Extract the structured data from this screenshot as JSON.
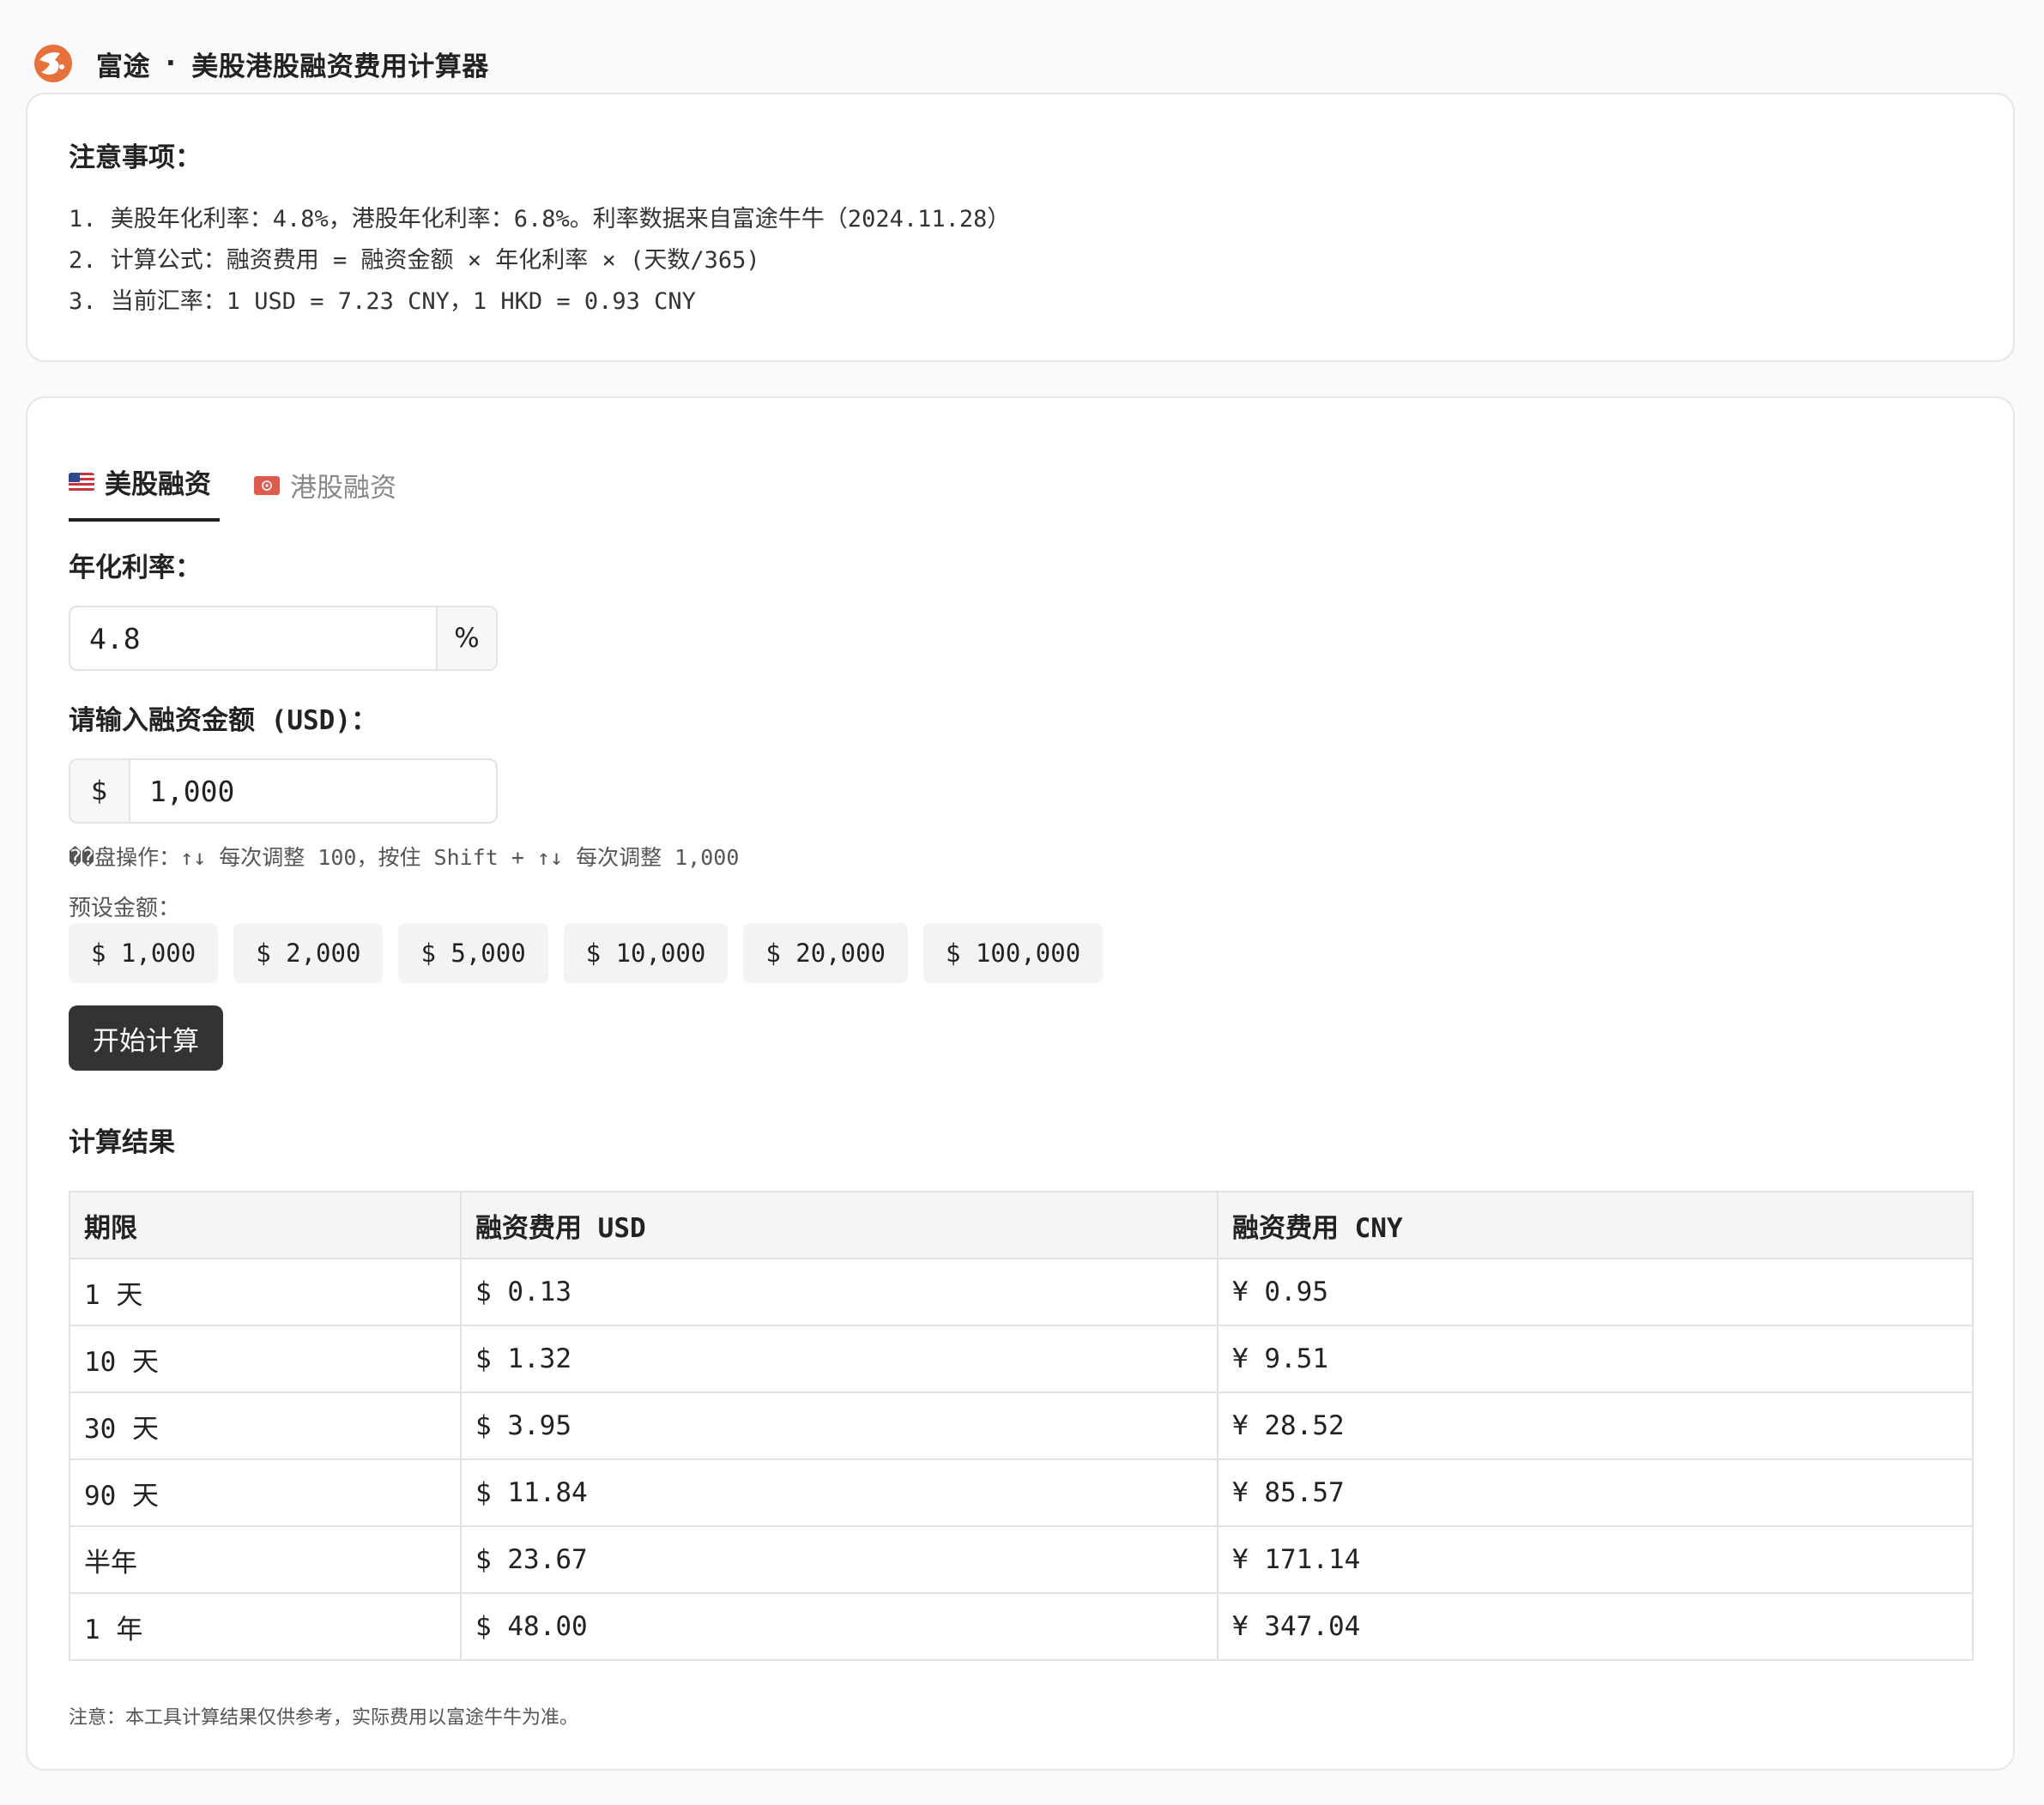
{
  "header": {
    "brand": "富途",
    "separator": "·",
    "title": "美股港股融资费用计算器"
  },
  "notes": {
    "title": "注意事项：",
    "items": [
      "1. 美股年化利率：4.8%，港股年化利率：6.8%。利率数据来自富途牛牛（2024.11.28）",
      "2. 计算公式：融资费用 = 融资金额 × 年化利率 × (天数/365)",
      "3. 当前汇率：1 USD = 7.23 CNY，1 HKD = 0.93 CNY"
    ]
  },
  "tabs": [
    {
      "label": "美股融资",
      "active": true
    },
    {
      "label": "港股融资",
      "active": false
    }
  ],
  "rate": {
    "label": "年化利率：",
    "value": "4.8",
    "unit": "%"
  },
  "amount": {
    "label": "请输入融资金额 (USD)：",
    "prefix": "$",
    "value": "1,000"
  },
  "hint": "��盘操作：↑↓ 每次调整 100，按住 Shift + ↑↓ 每次调整 1,000",
  "presets": {
    "label": "预设金额：",
    "items": [
      "$ 1,000",
      "$ 2,000",
      "$ 5,000",
      "$ 10,000",
      "$ 20,000",
      "$ 100,000"
    ]
  },
  "calculate_button": "开始计算",
  "results": {
    "title": "计算结果",
    "headers": [
      "期限",
      "融资费用 USD",
      "融资费用 CNY"
    ],
    "rows": [
      [
        "1 天",
        "$ 0.13",
        "¥ 0.95"
      ],
      [
        "10 天",
        "$ 1.32",
        "¥ 9.51"
      ],
      [
        "30 天",
        "$ 3.95",
        "¥ 28.52"
      ],
      [
        "90 天",
        "$ 11.84",
        "¥ 85.57"
      ],
      [
        "半年",
        "$ 23.67",
        "¥ 171.14"
      ],
      [
        "1 年",
        "$ 48.00",
        "¥ 347.04"
      ]
    ]
  },
  "footnote": "注意：本工具计算结果仅供参考，实际费用以富途牛牛为准。",
  "colors": {
    "accent": "#e8703a",
    "button": "#333333",
    "card_border": "#e6e6e6"
  }
}
